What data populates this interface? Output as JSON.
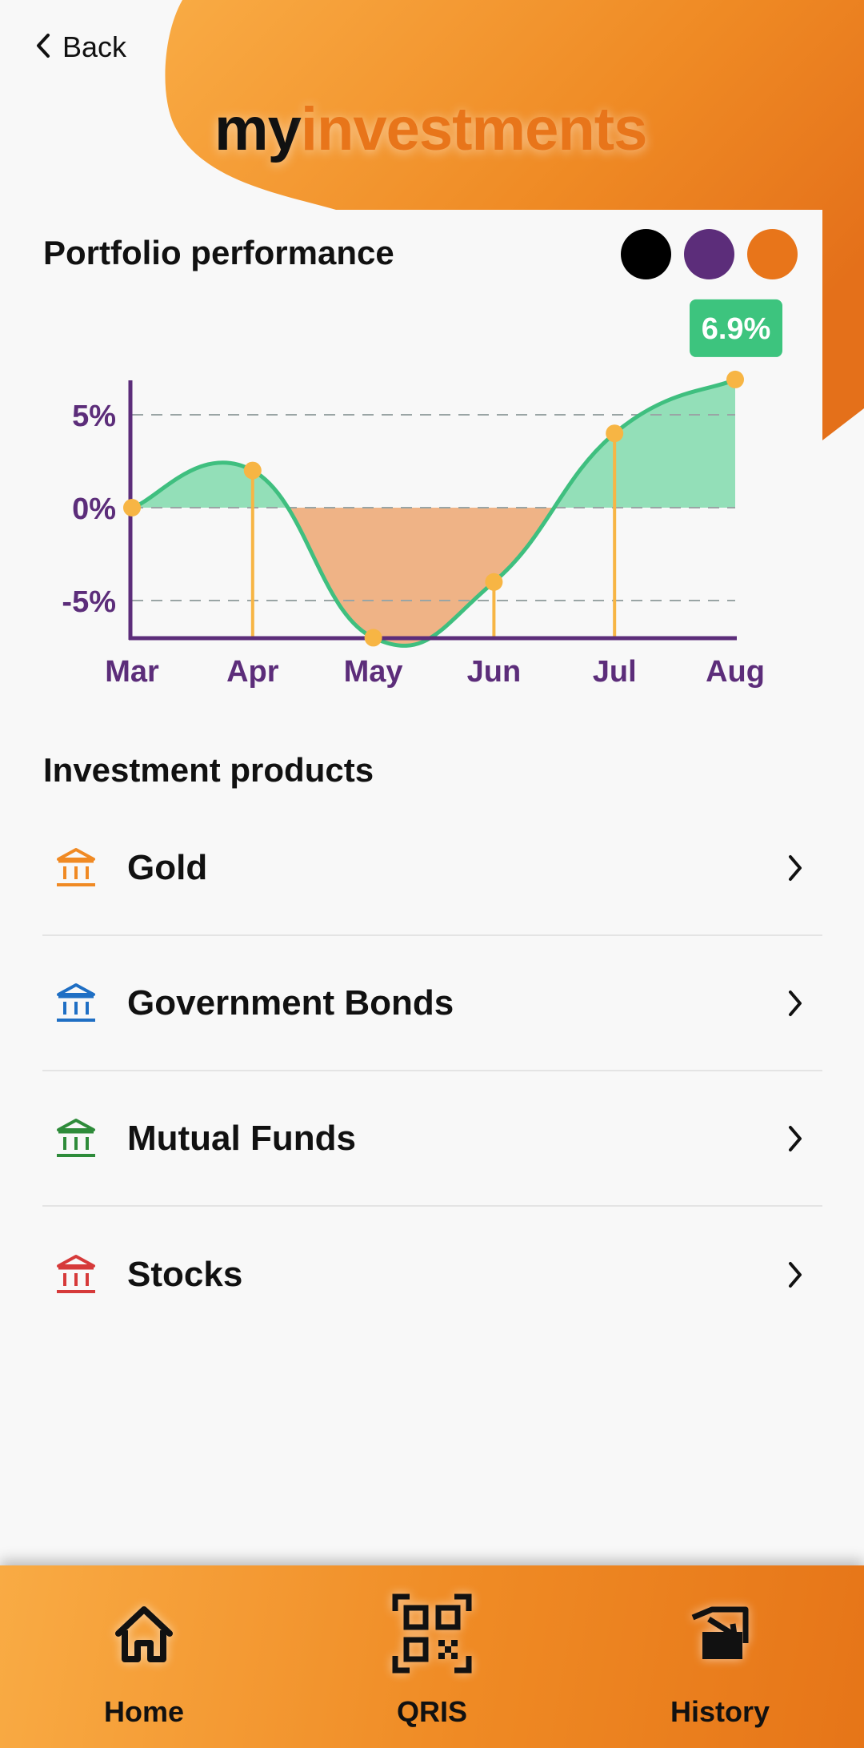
{
  "header": {
    "back_label": "Back",
    "brand_my": "my",
    "brand_investments": "investments",
    "accent_color": "#e8751a",
    "gradient_start": "#f9ab44",
    "gradient_end": "#e67518"
  },
  "portfolio": {
    "title": "Portfolio performance",
    "swatches": [
      {
        "name": "black",
        "color": "#000000"
      },
      {
        "name": "purple",
        "color": "#5c2d7a"
      },
      {
        "name": "orange",
        "color": "#e8751a"
      }
    ]
  },
  "chart_data": {
    "type": "area",
    "x": [
      "Mar",
      "Apr",
      "May",
      "Jun",
      "Jul",
      "Aug"
    ],
    "values": [
      0,
      2,
      -7,
      -4,
      4,
      6.9
    ],
    "ytick_labels": [
      "5%",
      "0%",
      "-5%"
    ],
    "yticks": [
      5,
      0,
      -5
    ],
    "ylim": [
      -7,
      7
    ],
    "callout": "6.9%",
    "grid": "dashed-horizontal",
    "positive_fill": "#93dfb8",
    "negative_fill": "#efb386",
    "line_color": "#3fbf7f",
    "marker_color": "#f7b544",
    "axis_color": "#5c2d7a",
    "callout_color": "#3dc47e"
  },
  "products": {
    "title": "Investment products",
    "items": [
      {
        "label": "Gold",
        "icon": "bank-icon",
        "color": "#f08a24"
      },
      {
        "label": "Government Bonds",
        "icon": "bank-icon",
        "color": "#1f6fc4"
      },
      {
        "label": "Mutual Funds",
        "icon": "bank-icon",
        "color": "#2e8b3a"
      },
      {
        "label": "Stocks",
        "icon": "bank-icon",
        "color": "#d63a3a"
      }
    ]
  },
  "nav": {
    "items": [
      {
        "label": "Home",
        "icon": "home-icon"
      },
      {
        "label": "QRIS",
        "icon": "qr-code-icon"
      },
      {
        "label": "History",
        "icon": "history-icon"
      }
    ]
  }
}
